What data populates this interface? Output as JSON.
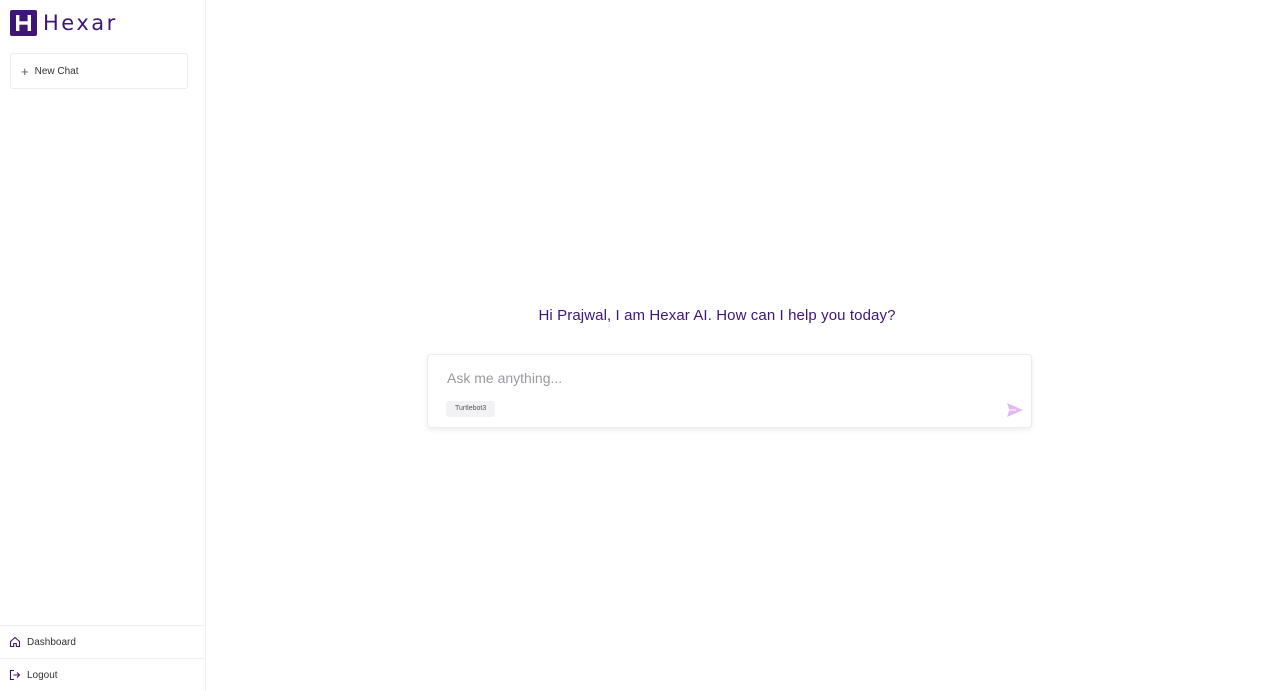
{
  "brand": {
    "name": "Hexar",
    "logo_letter": "H",
    "accent_color": "#3d1676"
  },
  "sidebar": {
    "new_chat_label": "New Chat",
    "new_chat_icon": "plus-icon",
    "bottom_links": [
      {
        "label": "Dashboard",
        "icon": "home-icon"
      },
      {
        "label": "Logout",
        "icon": "logout-icon"
      }
    ]
  },
  "main": {
    "greeting": "Hi Prajwal, I am Hexar AI. How can I help you today?",
    "composer": {
      "placeholder": "Ask me anything...",
      "value": "",
      "chip_label": "Turtlebot3",
      "send_icon": "send-icon",
      "send_color": "#e2b8f0"
    }
  }
}
